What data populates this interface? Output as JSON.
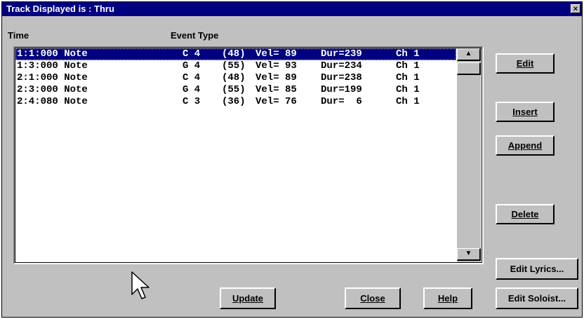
{
  "window": {
    "title": "Track Displayed is : Thru",
    "close_glyph": "×"
  },
  "columns": {
    "time": "Time",
    "event_type": "Event Type"
  },
  "events": [
    {
      "time": "1:1:000 Note",
      "note": "C 4",
      "num": "(48)",
      "vel": "Vel= 89",
      "dur": "Dur=239",
      "ch": "Ch 1",
      "selected": true
    },
    {
      "time": "1:3:000 Note",
      "note": "G 4",
      "num": "(55)",
      "vel": "Vel= 93",
      "dur": "Dur=234",
      "ch": "Ch 1",
      "selected": false
    },
    {
      "time": "2:1:000 Note",
      "note": "C 4",
      "num": "(48)",
      "vel": "Vel= 89",
      "dur": "Dur=238",
      "ch": "Ch 1",
      "selected": false
    },
    {
      "time": "2:3:000 Note",
      "note": "G 4",
      "num": "(55)",
      "vel": "Vel= 85",
      "dur": "Dur=199",
      "ch": "Ch 1",
      "selected": false
    },
    {
      "time": "2:4:080 Note",
      "note": "C 3",
      "num": "(36)",
      "vel": "Vel= 76",
      "dur": "Dur=  6",
      "ch": "Ch 1",
      "selected": false
    }
  ],
  "buttons": {
    "edit": "Edit",
    "insert": "Insert",
    "append": "Append",
    "delete": "Delete",
    "edit_lyrics": "Edit Lyrics...",
    "edit_soloist": "Edit Soloist...",
    "update": "Update",
    "close": "Close",
    "help": "Help"
  },
  "icons": {
    "scroll_up": "arrow-up-icon",
    "scroll_down": "arrow-down-icon",
    "pointer": "mouse-pointer-icon"
  },
  "colors": {
    "title_bg": "#000080",
    "face": "#c0c0c0",
    "selection": "#000080"
  }
}
